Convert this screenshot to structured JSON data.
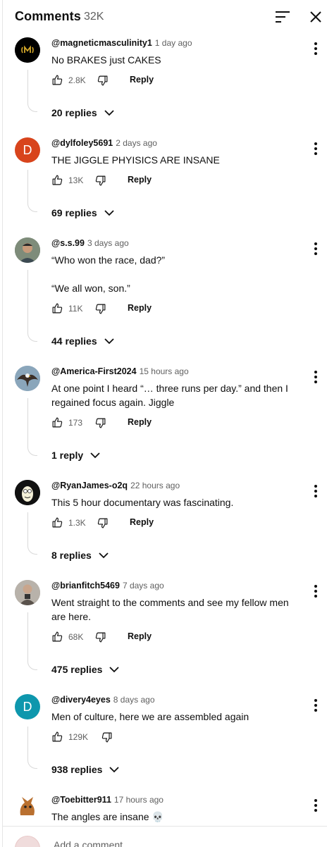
{
  "header": {
    "title": "Comments",
    "count": "32K"
  },
  "comments": [
    {
      "handle": "@magneticmasculinity1",
      "time": "1 day ago",
      "text": "No BRAKES just CAKES",
      "likes": "2.8K",
      "reply_label": "Reply",
      "replies_label": "20 replies",
      "avatar_color": "#000000"
    },
    {
      "handle": "@dylfoley5691",
      "time": "2 days ago",
      "text": "THE JIGGLE PHYISICS ARE INSANE",
      "likes": "13K",
      "reply_label": "Reply",
      "replies_label": "69 replies",
      "avatar_letter": "D",
      "avatar_color": "#d8441c"
    },
    {
      "handle": "@s.s.99",
      "time": "3 days ago",
      "text": "“Who won the race, dad?”\n\n“We all won, son.”",
      "likes": "11K",
      "reply_label": "Reply",
      "replies_label": "44 replies",
      "avatar_color": "#5a6a5a"
    },
    {
      "handle": "@America-First2024",
      "time": "15 hours ago",
      "text": "At one point I heard “… three runs per day.” and then I regained focus again. Jiggle",
      "likes": "173",
      "reply_label": "Reply",
      "replies_label": "1 reply",
      "avatar_color": "#7d9bb3"
    },
    {
      "handle": "@RyanJames-o2q",
      "time": "22 hours ago",
      "text": "This 5 hour documentary was fascinating.",
      "likes": "1.3K",
      "reply_label": "Reply",
      "replies_label": "8 replies",
      "avatar_color": "#111111"
    },
    {
      "handle": "@brianfitch5469",
      "time": "7 days ago",
      "text": "Went straight to the comments and see my fellow men are here.",
      "likes": "68K",
      "reply_label": "Reply",
      "replies_label": "475 replies",
      "avatar_color": "#a09a93"
    },
    {
      "handle": "@divery4eyes",
      "time": "8 days ago",
      "text": "Men of culture, here we are assembled again",
      "likes": "129K",
      "reply_label": "",
      "replies_label": "938 replies",
      "avatar_letter": "D",
      "avatar_color": "#0e97ad"
    },
    {
      "handle": "@Toebitter911",
      "time": "17 hours ago",
      "text": "The angles are insane 💀",
      "avatar_color": "#c87a3a"
    }
  ],
  "composer": {
    "placeholder": "Add a comment..."
  }
}
